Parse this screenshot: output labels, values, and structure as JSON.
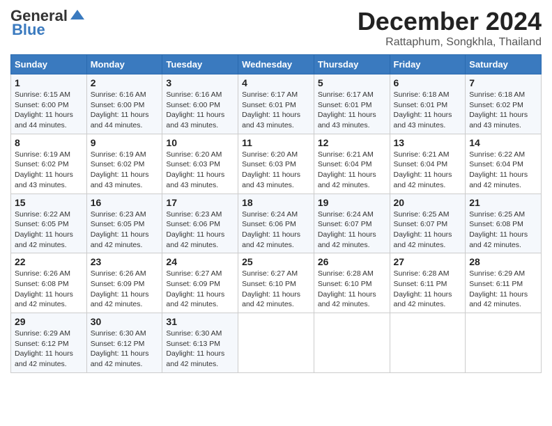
{
  "logo": {
    "line1": "General",
    "line2": "Blue"
  },
  "title": "December 2024",
  "subtitle": "Rattaphum, Songkhla, Thailand",
  "days_of_week": [
    "Sunday",
    "Monday",
    "Tuesday",
    "Wednesday",
    "Thursday",
    "Friday",
    "Saturday"
  ],
  "weeks": [
    [
      {
        "day": "1",
        "sunrise": "6:15 AM",
        "sunset": "6:00 PM",
        "daylight": "11 hours and 44 minutes."
      },
      {
        "day": "2",
        "sunrise": "6:16 AM",
        "sunset": "6:00 PM",
        "daylight": "11 hours and 44 minutes."
      },
      {
        "day": "3",
        "sunrise": "6:16 AM",
        "sunset": "6:00 PM",
        "daylight": "11 hours and 43 minutes."
      },
      {
        "day": "4",
        "sunrise": "6:17 AM",
        "sunset": "6:01 PM",
        "daylight": "11 hours and 43 minutes."
      },
      {
        "day": "5",
        "sunrise": "6:17 AM",
        "sunset": "6:01 PM",
        "daylight": "11 hours and 43 minutes."
      },
      {
        "day": "6",
        "sunrise": "6:18 AM",
        "sunset": "6:01 PM",
        "daylight": "11 hours and 43 minutes."
      },
      {
        "day": "7",
        "sunrise": "6:18 AM",
        "sunset": "6:02 PM",
        "daylight": "11 hours and 43 minutes."
      }
    ],
    [
      {
        "day": "8",
        "sunrise": "6:19 AM",
        "sunset": "6:02 PM",
        "daylight": "11 hours and 43 minutes."
      },
      {
        "day": "9",
        "sunrise": "6:19 AM",
        "sunset": "6:02 PM",
        "daylight": "11 hours and 43 minutes."
      },
      {
        "day": "10",
        "sunrise": "6:20 AM",
        "sunset": "6:03 PM",
        "daylight": "11 hours and 43 minutes."
      },
      {
        "day": "11",
        "sunrise": "6:20 AM",
        "sunset": "6:03 PM",
        "daylight": "11 hours and 43 minutes."
      },
      {
        "day": "12",
        "sunrise": "6:21 AM",
        "sunset": "6:04 PM",
        "daylight": "11 hours and 42 minutes."
      },
      {
        "day": "13",
        "sunrise": "6:21 AM",
        "sunset": "6:04 PM",
        "daylight": "11 hours and 42 minutes."
      },
      {
        "day": "14",
        "sunrise": "6:22 AM",
        "sunset": "6:04 PM",
        "daylight": "11 hours and 42 minutes."
      }
    ],
    [
      {
        "day": "15",
        "sunrise": "6:22 AM",
        "sunset": "6:05 PM",
        "daylight": "11 hours and 42 minutes."
      },
      {
        "day": "16",
        "sunrise": "6:23 AM",
        "sunset": "6:05 PM",
        "daylight": "11 hours and 42 minutes."
      },
      {
        "day": "17",
        "sunrise": "6:23 AM",
        "sunset": "6:06 PM",
        "daylight": "11 hours and 42 minutes."
      },
      {
        "day": "18",
        "sunrise": "6:24 AM",
        "sunset": "6:06 PM",
        "daylight": "11 hours and 42 minutes."
      },
      {
        "day": "19",
        "sunrise": "6:24 AM",
        "sunset": "6:07 PM",
        "daylight": "11 hours and 42 minutes."
      },
      {
        "day": "20",
        "sunrise": "6:25 AM",
        "sunset": "6:07 PM",
        "daylight": "11 hours and 42 minutes."
      },
      {
        "day": "21",
        "sunrise": "6:25 AM",
        "sunset": "6:08 PM",
        "daylight": "11 hours and 42 minutes."
      }
    ],
    [
      {
        "day": "22",
        "sunrise": "6:26 AM",
        "sunset": "6:08 PM",
        "daylight": "11 hours and 42 minutes."
      },
      {
        "day": "23",
        "sunrise": "6:26 AM",
        "sunset": "6:09 PM",
        "daylight": "11 hours and 42 minutes."
      },
      {
        "day": "24",
        "sunrise": "6:27 AM",
        "sunset": "6:09 PM",
        "daylight": "11 hours and 42 minutes."
      },
      {
        "day": "25",
        "sunrise": "6:27 AM",
        "sunset": "6:10 PM",
        "daylight": "11 hours and 42 minutes."
      },
      {
        "day": "26",
        "sunrise": "6:28 AM",
        "sunset": "6:10 PM",
        "daylight": "11 hours and 42 minutes."
      },
      {
        "day": "27",
        "sunrise": "6:28 AM",
        "sunset": "6:11 PM",
        "daylight": "11 hours and 42 minutes."
      },
      {
        "day": "28",
        "sunrise": "6:29 AM",
        "sunset": "6:11 PM",
        "daylight": "11 hours and 42 minutes."
      }
    ],
    [
      {
        "day": "29",
        "sunrise": "6:29 AM",
        "sunset": "6:12 PM",
        "daylight": "11 hours and 42 minutes."
      },
      {
        "day": "30",
        "sunrise": "6:30 AM",
        "sunset": "6:12 PM",
        "daylight": "11 hours and 42 minutes."
      },
      {
        "day": "31",
        "sunrise": "6:30 AM",
        "sunset": "6:13 PM",
        "daylight": "11 hours and 42 minutes."
      },
      null,
      null,
      null,
      null
    ]
  ]
}
